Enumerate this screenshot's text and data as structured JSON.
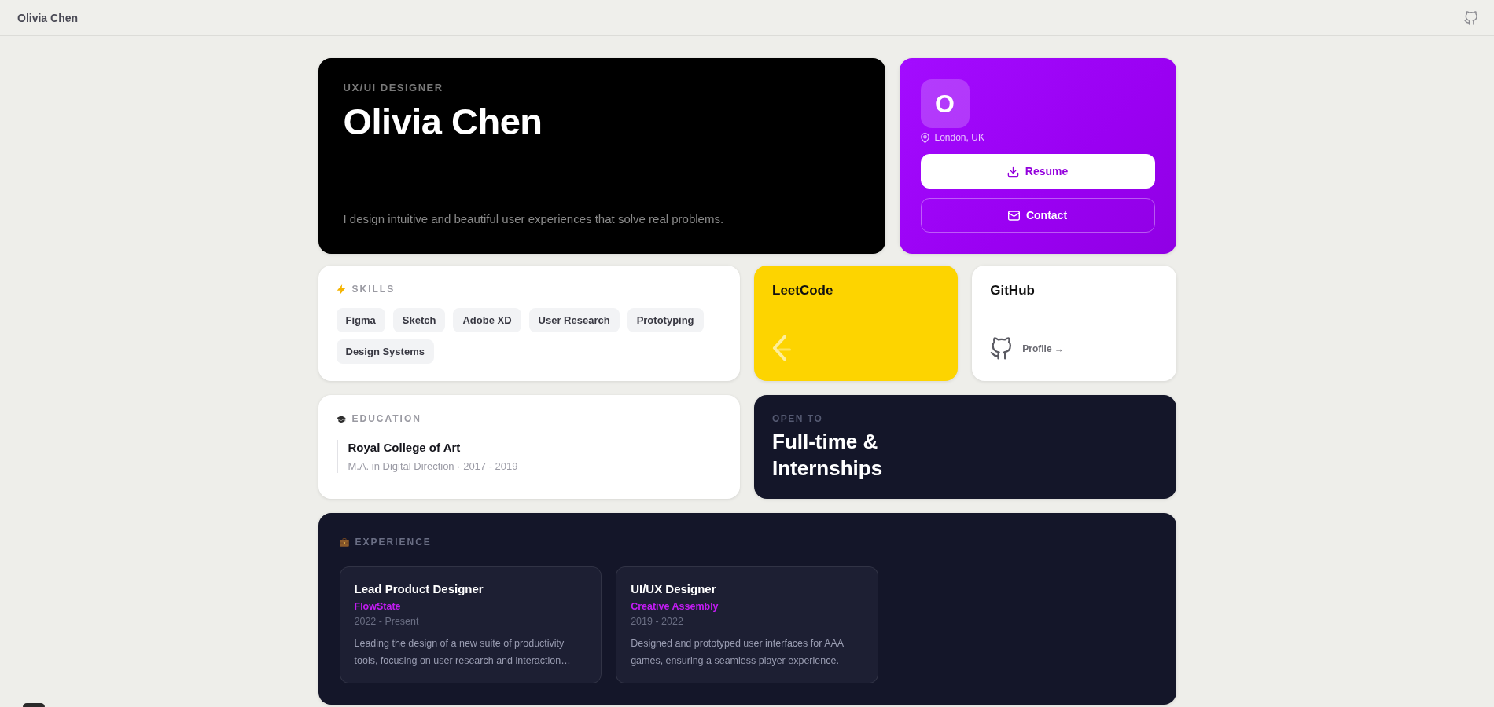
{
  "header": {
    "title": "Olivia Chen"
  },
  "hero": {
    "eyebrow": "UX/UI DESIGNER",
    "name": "Olivia Chen",
    "tagline": "I design intuitive and beautiful user experiences that solve real problems."
  },
  "profile_card": {
    "avatar_letter": "O",
    "location": "London, UK",
    "buttons": [
      {
        "label": "Resume",
        "kind": "primary"
      },
      {
        "label": "Contact",
        "kind": "outline"
      }
    ]
  },
  "skills": {
    "title": "SKILLS",
    "tags": [
      "Figma",
      "Sketch",
      "Adobe XD",
      "User Research",
      "Prototyping",
      "Design Systems"
    ]
  },
  "leetcode": {
    "title": "LeetCode"
  },
  "github": {
    "title": "GitHub",
    "link": "Profile →"
  },
  "education": {
    "title": "EDUCATION",
    "entries": [
      {
        "school": "Royal College of Art",
        "detail": "M.A. in Digital Direction · 2017 - 2019"
      }
    ]
  },
  "open_to": {
    "label": "OPEN TO",
    "value": "Full-time & Internships"
  },
  "experience": {
    "title": "EXPERIENCE",
    "jobs": [
      {
        "title": "Lead Product Designer",
        "company": "FlowState",
        "dates": "2022 - Present",
        "description": "Leading the design of a new suite of productivity tools, focusing on user research and interaction…"
      },
      {
        "title": "UI/UX Designer",
        "company": "Creative Assembly",
        "dates": "2019 - 2022",
        "description": "Designed and prototyped user interfaces for AAA games, ensuring a seamless player experience."
      }
    ]
  }
}
